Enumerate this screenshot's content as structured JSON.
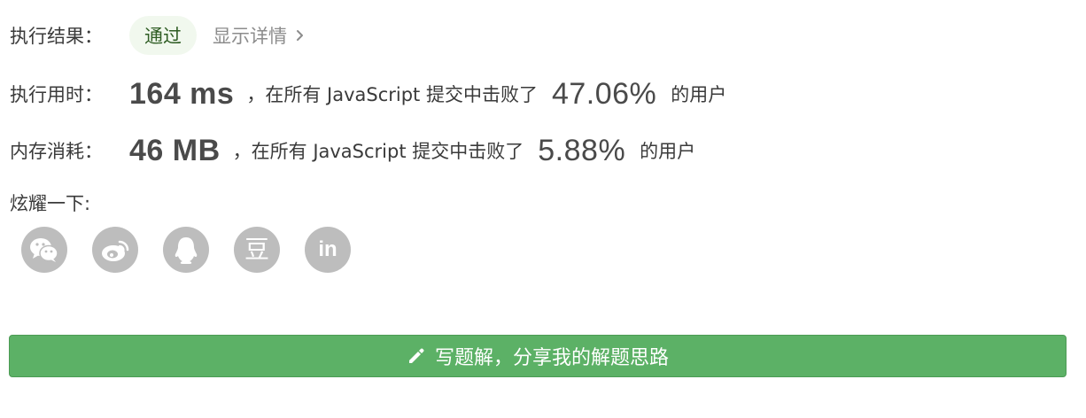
{
  "result": {
    "label": "执行结果：",
    "status": "通过",
    "details_link": "显示详情"
  },
  "runtime": {
    "label": "执行用时：",
    "value": "164 ms",
    "middle": "，在所有 JavaScript 提交中击败了",
    "percent": "47.06%",
    "suffix": "的用户"
  },
  "memory": {
    "label": "内存消耗：",
    "value": "46 MB",
    "middle": "，在所有 JavaScript 提交中击败了",
    "percent": "5.88%",
    "suffix": "的用户"
  },
  "share": {
    "label": "炫耀一下:",
    "icons": [
      "wechat-icon",
      "weibo-icon",
      "qq-icon",
      "douban-icon",
      "linkedin-icon"
    ],
    "douban_glyph": "豆",
    "linkedin_glyph": "in"
  },
  "action": {
    "write_solution_label": "写题解，分享我的解题思路"
  },
  "colors": {
    "accent_green": "#5cb166",
    "badge_bg": "#f1f8ee",
    "icon_gray": "#bdbdbd"
  }
}
